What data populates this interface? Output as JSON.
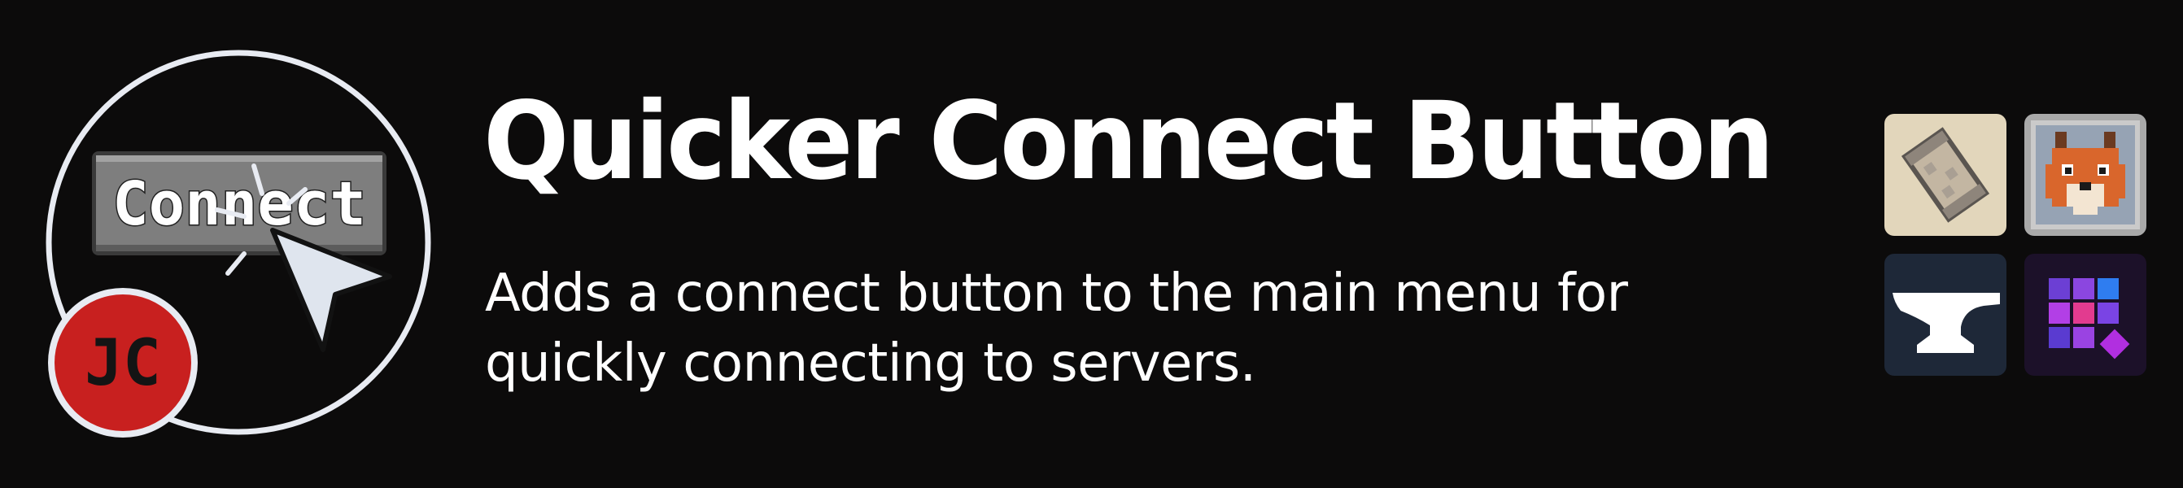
{
  "header": {
    "title": "Quicker Connect Button",
    "description": "Adds a connect button to the main menu for quickly connecting to servers."
  },
  "logo": {
    "button_text": "Connect",
    "author_initials": "JC",
    "icons": [
      "connect-button-icon",
      "cursor-arrow-icon",
      "author-badge-icon"
    ]
  },
  "platforms": [
    {
      "name": "paper-scroll-icon"
    },
    {
      "name": "fox-face-icon"
    },
    {
      "name": "anvil-icon"
    },
    {
      "name": "puzzle-grid-icon"
    }
  ],
  "colors": {
    "background": "#0c0b0b",
    "text": "#ffffff",
    "author_badge": "#c8201f",
    "ring": "#e8ebf2",
    "cursor": "#dfe5ee"
  }
}
